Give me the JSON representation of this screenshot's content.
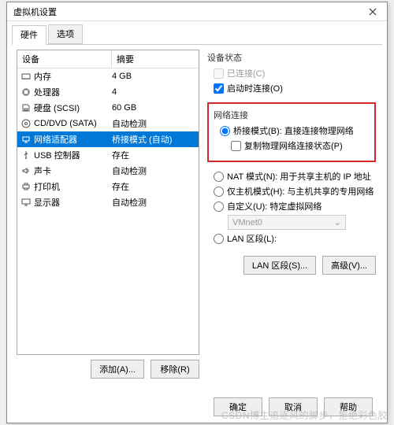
{
  "title": "虚拟机设置",
  "tabs": {
    "hardware": "硬件",
    "options": "选项"
  },
  "columns": {
    "device": "设备",
    "summary": "摘要"
  },
  "devices": [
    {
      "icon": "memory",
      "name": "内存",
      "summary": "4 GB"
    },
    {
      "icon": "cpu",
      "name": "处理器",
      "summary": "4"
    },
    {
      "icon": "disk",
      "name": "硬盘 (SCSI)",
      "summary": "60 GB"
    },
    {
      "icon": "cd",
      "name": "CD/DVD (SATA)",
      "summary": "自动检测"
    },
    {
      "icon": "net",
      "name": "网络适配器",
      "summary": "桥接模式 (自动)"
    },
    {
      "icon": "usb",
      "name": "USB 控制器",
      "summary": "存在"
    },
    {
      "icon": "sound",
      "name": "声卡",
      "summary": "自动检测"
    },
    {
      "icon": "printer",
      "name": "打印机",
      "summary": "存在"
    },
    {
      "icon": "display",
      "name": "显示器",
      "summary": "自动检测"
    }
  ],
  "selected_index": 4,
  "left_buttons": {
    "add": "添加(A)...",
    "remove": "移除(R)"
  },
  "status": {
    "title": "设备状态",
    "connected": "已连接(C)",
    "connect_on_power": "启动时连接(O)"
  },
  "network": {
    "title": "网络连接",
    "bridged": "桥接模式(B): 直接连接物理网络",
    "replicate": "复制物理网络连接状态(P)",
    "nat": "NAT 模式(N): 用于共享主机的 IP 地址",
    "hostonly": "仅主机模式(H): 与主机共享的专用网络",
    "custom": "自定义(U): 特定虚拟网络",
    "vmnet": "VMnet0",
    "lan": "LAN 区段(L):"
  },
  "right_buttons": {
    "lan": "LAN 区段(S)...",
    "advanced": "高级(V)..."
  },
  "footer": {
    "ok": "确定",
    "cancel": "取消",
    "help": "帮助"
  },
  "watermark": "CSDN博主追逐风的脚步，拒绝彩色胶"
}
